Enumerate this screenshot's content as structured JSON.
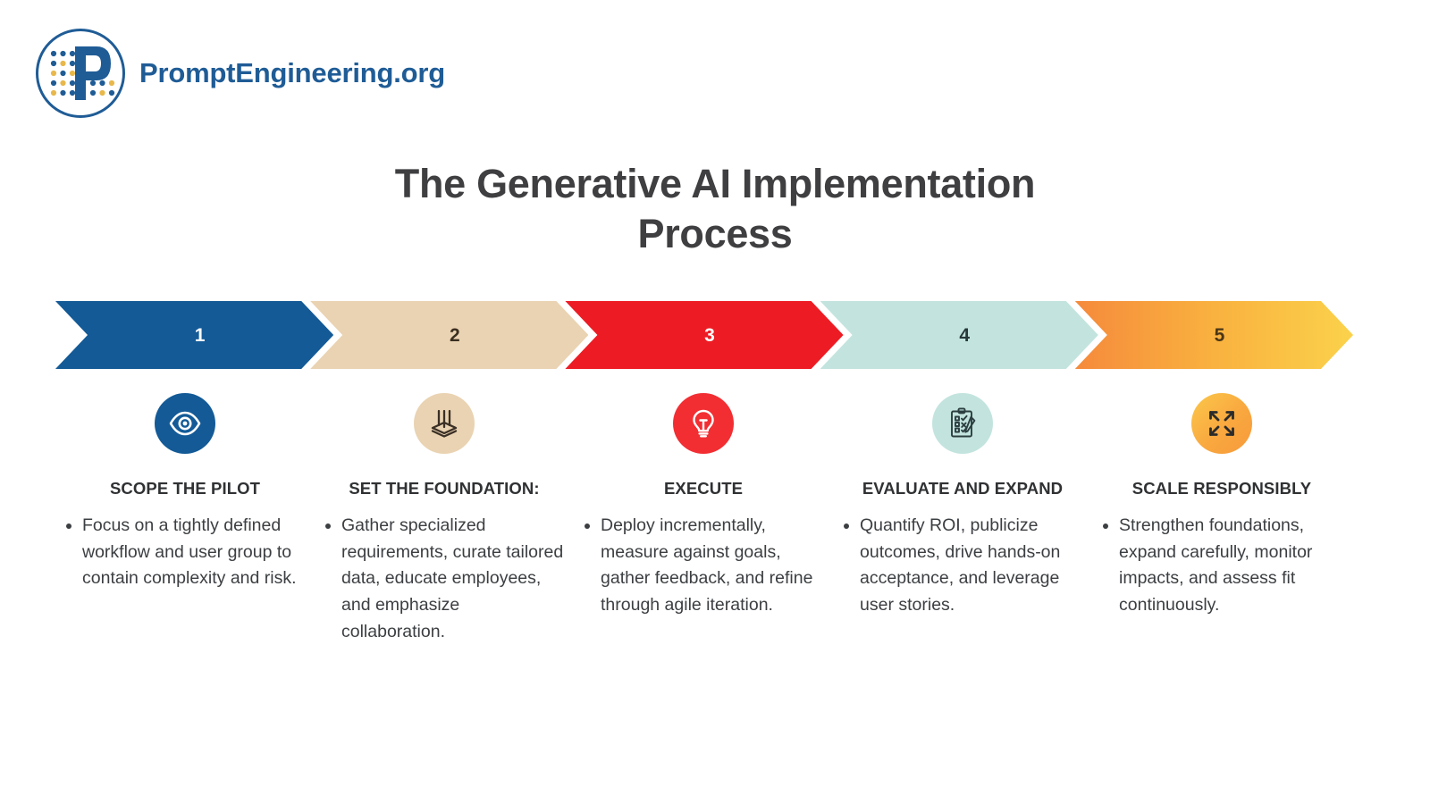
{
  "brand": {
    "name": "PromptEngineering.org",
    "logo_icon": "promptengineering-p-logo-icon",
    "brand_color": "#1F5C96",
    "accent_color": "#E8B84B"
  },
  "title": {
    "line1": "The Generative AI Implementation",
    "line2": "Process"
  },
  "chart_data": {
    "type": "table",
    "title": "The Generative AI Implementation Process",
    "steps": [
      {
        "number": "1",
        "heading": "SCOPE THE PILOT",
        "bullets": [
          "Focus on a tightly defined workflow and user group to contain complexity and risk."
        ],
        "icon": "eye-icon",
        "chevron_color": "#135A97",
        "number_color": "#FFFFFF",
        "circle_color": "#135A97"
      },
      {
        "number": "2",
        "heading": "SET THE FOUNDATION:",
        "bullets": [
          "Gather specialized requirements, curate tailored data, educate employees, and emphasize collaboration."
        ],
        "icon": "foundation-piles-icon",
        "chevron_color": "#EAD3B2",
        "number_color": "#3A2F20",
        "circle_color": "#EAD3B2"
      },
      {
        "number": "3",
        "heading": "EXECUTE",
        "bullets": [
          "Deploy incrementally, measure against goals, gather feedback, and refine through agile iteration."
        ],
        "icon": "lightbulb-icon",
        "chevron_color": "#ED1C24",
        "number_color": "#FFFFFF",
        "circle_color": "#F22E33"
      },
      {
        "number": "4",
        "heading": "EVALUATE AND EXPAND",
        "bullets": [
          "Quantify ROI, publicize outcomes, drive hands-on acceptance, and leverage user stories."
        ],
        "icon": "clipboard-checklist-pencil-icon",
        "chevron_color": "#C3E4DE",
        "number_color": "#26373A",
        "circle_color": "#C3E4DE"
      },
      {
        "number": "5",
        "heading": "SCALE RESPONSIBLY",
        "bullets": [
          "Strengthen foundations, expand carefully, monitor impacts, and assess fit continuously."
        ],
        "icon": "expand-arrows-icon",
        "chevron_color": "#F9B03F",
        "number_color": "#4A3616",
        "circle_color": "#F9A83F"
      }
    ]
  }
}
